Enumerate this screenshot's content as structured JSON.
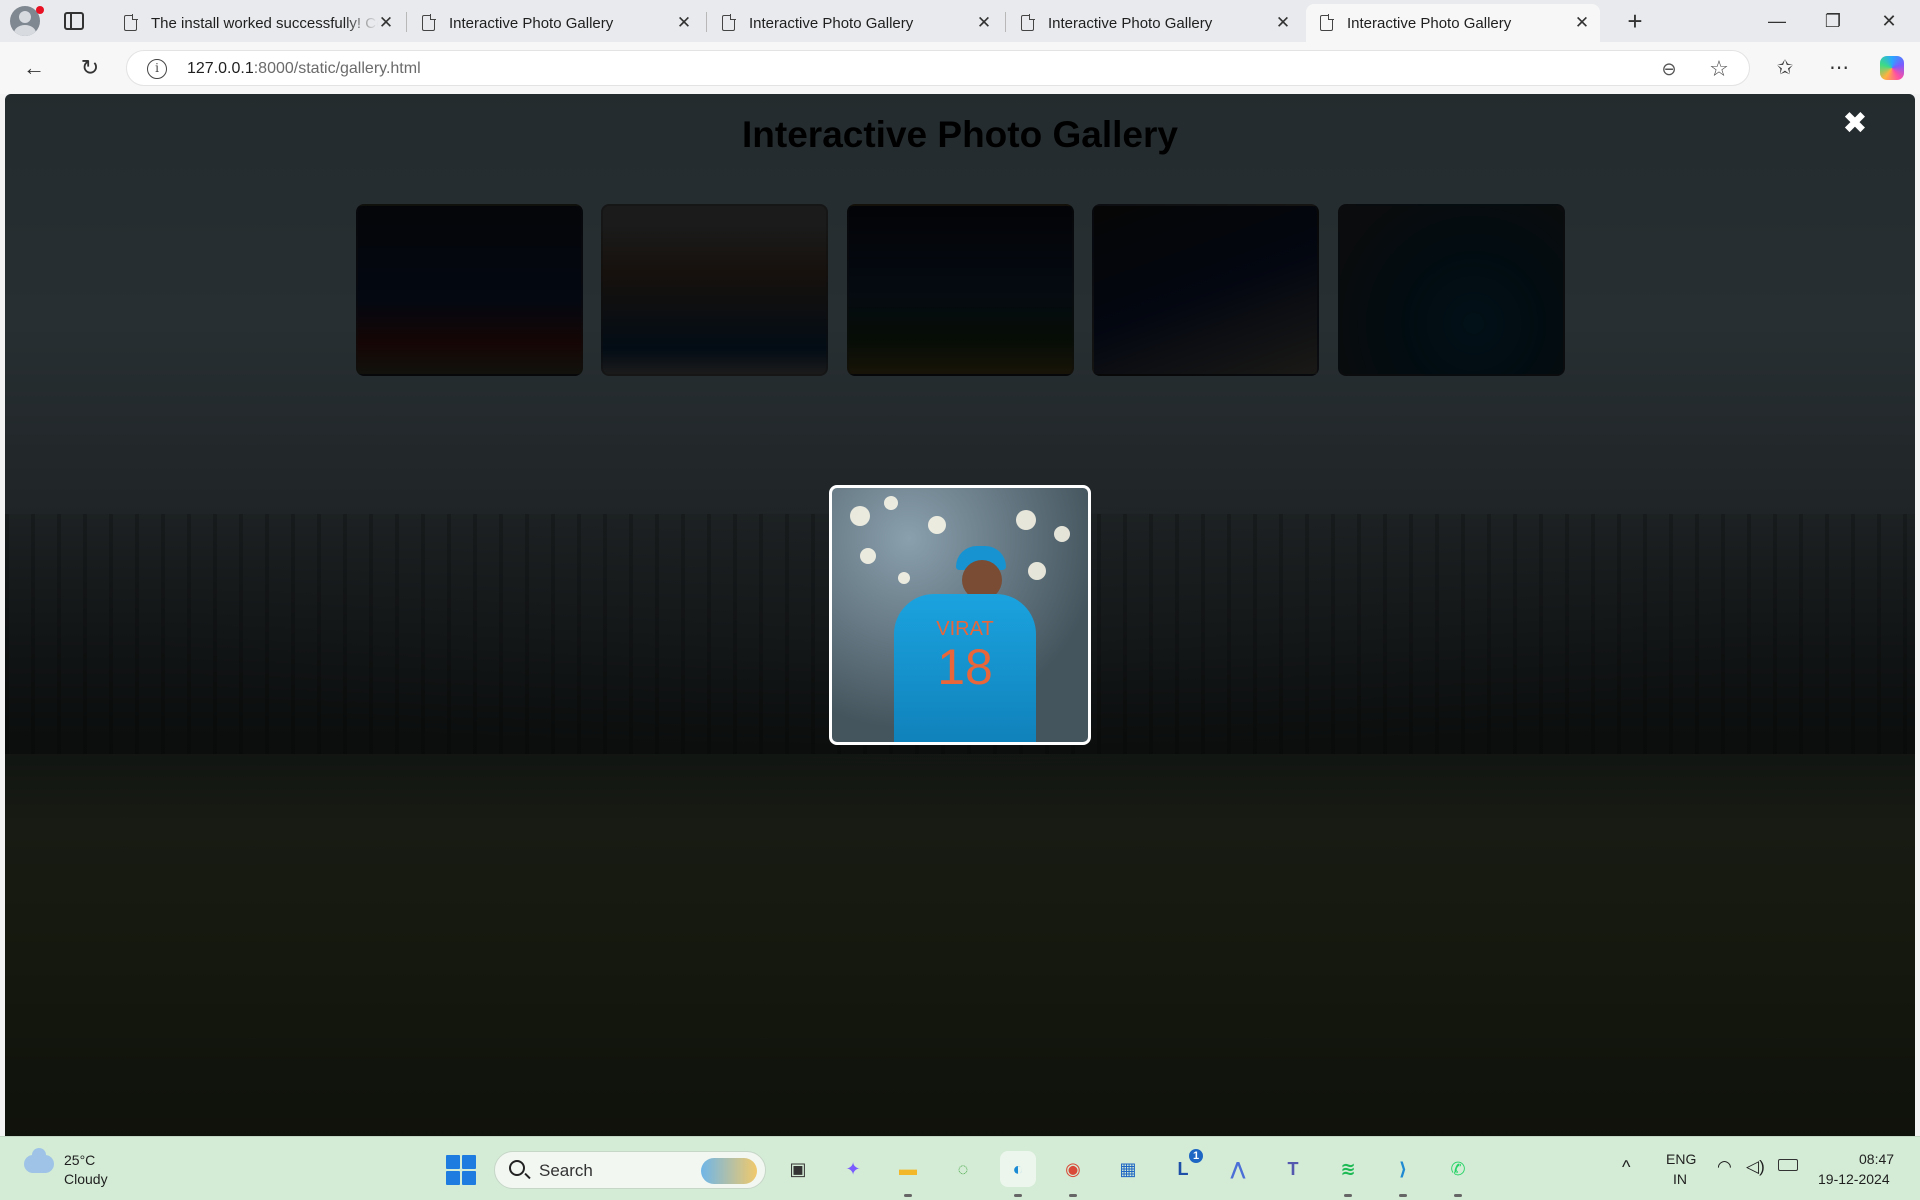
{
  "browser": {
    "tabs": [
      {
        "title": "The install worked successfully! Co",
        "active": false
      },
      {
        "title": "Interactive Photo Gallery",
        "active": false
      },
      {
        "title": "Interactive Photo Gallery",
        "active": false
      },
      {
        "title": "Interactive Photo Gallery",
        "active": false
      },
      {
        "title": "Interactive Photo Gallery",
        "active": true
      }
    ],
    "tab_close_glyph": "✕",
    "new_tab_glyph": "+",
    "window_controls": {
      "minimize": "—",
      "maximize": "❐",
      "close": "✕"
    },
    "url_host": "127.0.0.1",
    "url_rest": ":8000/static/gallery.html",
    "nav": {
      "back": "←",
      "reload": "↻"
    },
    "icons": {
      "info": "i",
      "zoom": "⊖",
      "favorite": "☆",
      "favorites_bar": "✩",
      "menu": "⋯"
    }
  },
  "page": {
    "title": "Interactive Photo Gallery",
    "close_glyph": "✖",
    "thumbnails": [
      {
        "label": "player-7",
        "colors": [
          "#1f4a9c",
          "#c13a2c"
        ]
      },
      {
        "label": "player-portrait",
        "colors": [
          "#f0f0f0",
          "#1d6dbf"
        ]
      },
      {
        "label": "player-batting",
        "colors": [
          "#2f5e9c",
          "#d8b04a"
        ]
      },
      {
        "label": "player-celebrating",
        "colors": [
          "#1e3f94",
          "#e8e0c8"
        ]
      },
      {
        "label": "player-18",
        "colors": [
          "#1893d1",
          "#8aa0ad"
        ]
      }
    ],
    "modal": {
      "jersey_name": "VIRAT",
      "jersey_number": "18"
    }
  },
  "taskbar": {
    "weather_temp": "25°C",
    "weather_desc": "Cloudy",
    "search_placeholder": "Search",
    "apps": [
      {
        "name": "task-view-icon",
        "glyph": "▣",
        "color": "#333333"
      },
      {
        "name": "copilot-app-icon",
        "glyph": "✦",
        "color": "#7a5cff"
      },
      {
        "name": "file-explorer-icon",
        "glyph": "▬",
        "color": "#f2b829"
      },
      {
        "name": "cursor-ring-icon",
        "glyph": "◌",
        "color": "#3da33d"
      },
      {
        "name": "edge-icon",
        "glyph": "◐",
        "color": "#1a8ad4"
      },
      {
        "name": "chrome-icon",
        "glyph": "◉",
        "color": "#d94a38"
      },
      {
        "name": "store-icon",
        "glyph": "▦",
        "color": "#1e66c4"
      },
      {
        "name": "l-app-icon",
        "glyph": "L",
        "color": "#1e4fa8"
      },
      {
        "name": "arc-app-icon",
        "glyph": "⋀",
        "color": "#4b6fd6"
      },
      {
        "name": "teams-icon",
        "glyph": "T",
        "color": "#5558af"
      },
      {
        "name": "spotify-icon",
        "glyph": "≋",
        "color": "#1db954"
      },
      {
        "name": "vscode-icon",
        "glyph": "⟩",
        "color": "#1f8ad2"
      },
      {
        "name": "whatsapp-icon",
        "glyph": "✆",
        "color": "#25d366"
      }
    ],
    "l_app_badge": "1",
    "language_top": "ENG",
    "language_bottom": "IN",
    "chevron": "^",
    "time": "08:47",
    "date": "19-12-2024"
  }
}
